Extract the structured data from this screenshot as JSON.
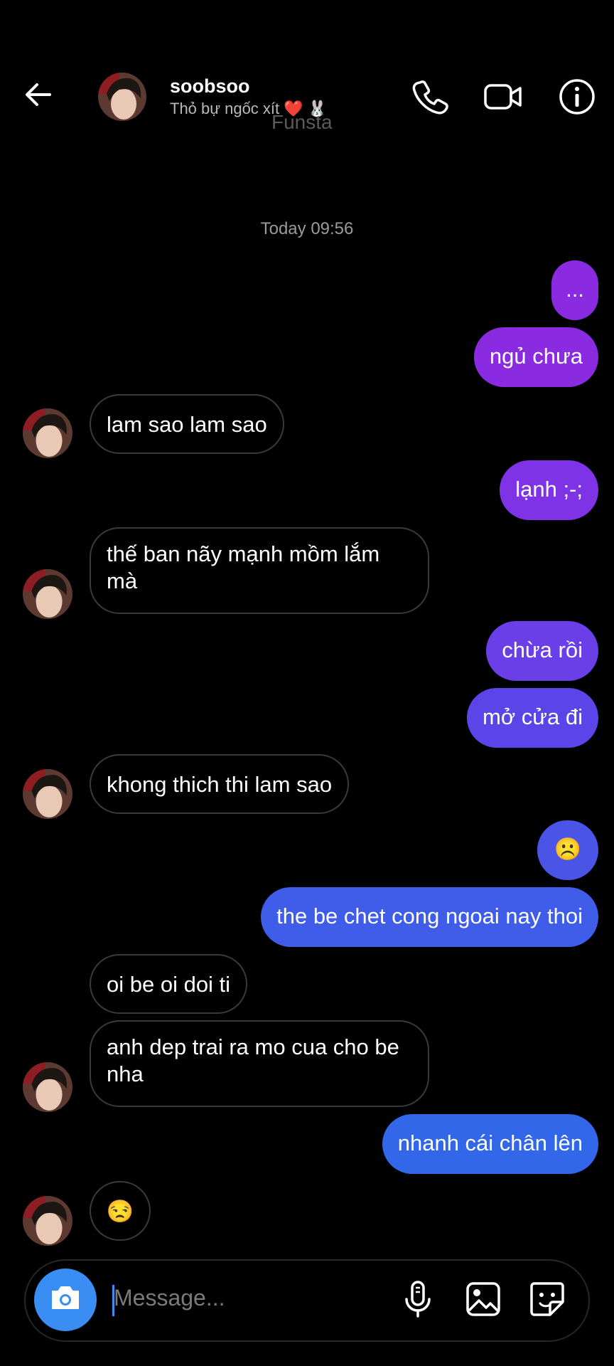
{
  "header": {
    "name": "soobsoo",
    "status_text": "Thỏ bự ngốc xít",
    "status_heart": "❤️",
    "status_rabbit": "🐰",
    "watermark": "Funsta",
    "icons": [
      "back-arrow-icon",
      "phone-icon",
      "video-call-icon",
      "info-icon"
    ]
  },
  "timestamp": "Today 09:56",
  "messages": [
    {
      "from": "me",
      "text": "..."
    },
    {
      "from": "me",
      "text": "ngủ chưa"
    },
    {
      "from": "them",
      "text": "lam sao lam sao"
    },
    {
      "from": "me",
      "text": "lạnh ;-;"
    },
    {
      "from": "them",
      "text": "thế ban nãy mạnh mồm lắm mà"
    },
    {
      "from": "me",
      "text": "chừa rồi"
    },
    {
      "from": "me",
      "text": "mở cửa đi"
    },
    {
      "from": "them",
      "text": "khong thich thi lam sao"
    },
    {
      "from": "me",
      "text": "☹️"
    },
    {
      "from": "me",
      "text": "the be chet cong ngoai nay thoi"
    },
    {
      "from": "them",
      "text": "oi be oi doi ti"
    },
    {
      "from": "them",
      "text": "anh dep trai ra mo cua cho be nha"
    },
    {
      "from": "me",
      "text": "nhanh cái chân lên"
    },
    {
      "from": "them",
      "text": "😒"
    }
  ],
  "composer": {
    "placeholder": "Message...",
    "icons": [
      "camera-icon",
      "microphone-icon",
      "gallery-icon",
      "sticker-icon"
    ]
  },
  "colors": {
    "out_purple": "#8a2be2",
    "out_indigo": "#5b4fe6",
    "out_blue": "#3267ea",
    "accent_blue": "#3a8df2",
    "background": "#000000"
  }
}
